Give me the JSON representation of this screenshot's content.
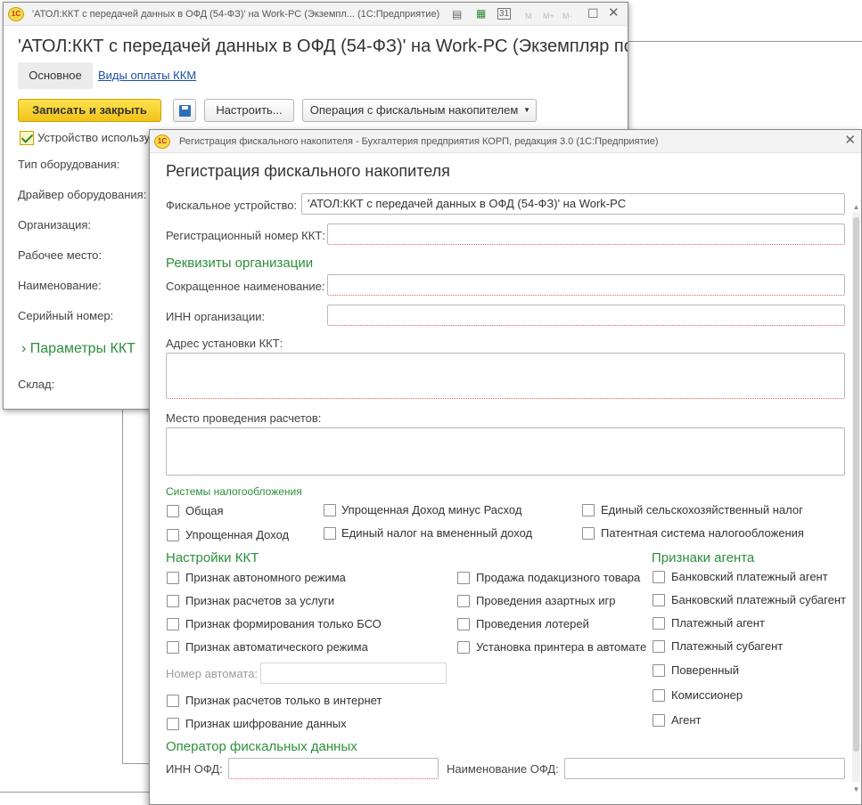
{
  "background_window": {
    "title": "'АТОЛ:ККТ с передачей данных в ОФД (54-ФЗ)' на Work-PC (Экземпл...   (1С:Предприятие)",
    "heading": "'АТОЛ:ККТ с передачей данных в ОФД (54-ФЗ)' на Work-PC (Экземпляр по...",
    "tabs": [
      "Основное",
      "Виды оплаты ККМ"
    ],
    "buttons": {
      "save_close": "Записать и закрыть",
      "configure": "Настроить...",
      "fiscal_op": "Операция с фискальным накопителем"
    },
    "checkbox_device": "Устройство использу",
    "fields": [
      "Тип оборудования:",
      "Драйвер оборудования:",
      "Организация:",
      "Рабочее место:",
      "Наименование:",
      "Серийный номер:"
    ],
    "params_section": "Параметры ККТ",
    "warehouse_label": "Склад:",
    "toolbar_dim": [
      "M",
      "M+",
      "M-"
    ],
    "calendar_day": "31"
  },
  "dialog": {
    "title": "Регистрация фискального накопителя - Бухгалтерия предприятия КОРП, редакция 3.0  (1С:Предприятие)",
    "heading": "Регистрация фискального накопителя",
    "fiscal_device_label": "Фискальное устройство:",
    "fiscal_device_value": "'АТОЛ:ККТ с передачей данных в ОФД (54-ФЗ)' на Work-PC",
    "reg_number_label": "Регистрационный номер ККТ:",
    "org_section": "Реквизиты организации",
    "short_name_label": "Сокращенное наименование:",
    "inn_label": "ИНН организации:",
    "address_label": "Адрес установки ККТ:",
    "place_label": "Место проведения расчетов:",
    "tax_section": "Системы налогообложения",
    "tax_options": {
      "general": "Общая",
      "simplified_income_minus": "Упрощенная Доход минус Расход",
      "agricultural": "Единый сельскохозяйственный налог",
      "simplified_income": "Упрощенная Доход",
      "imputed": "Единый налог на вмененный доход",
      "patent": "Патентная система налогообложения"
    },
    "kkt_section": "Настройки ККТ",
    "kkt_options": {
      "autonomous": "Признак автономного режима",
      "services": "Признак расчетов за услуги",
      "bso_only": "Признак формирования только БСО",
      "automatic": "Признак автоматического режима",
      "internet_only": "Признак расчетов только в интернет",
      "encryption": "Признак шифрование данных",
      "excise": "Продажа подакцизного товара",
      "gambling": "Проведения азартных игр",
      "lottery": "Проведения лотерей",
      "printer_in_machine": "Установка принтера в автомате"
    },
    "machine_number_label": "Номер автомата:",
    "agent_section": "Признаки агента",
    "agent_options": {
      "bank_agent": "Банковский платежный агент",
      "bank_subagent": "Банковский платежный субагент",
      "pay_agent": "Платежный агент",
      "pay_subagent": "Платежный субагент",
      "attorney": "Поверенный",
      "commissioner": "Комиссионер",
      "agent": "Агент"
    },
    "ofd_section": "Оператор фискальных данных",
    "ofd_inn_label": "ИНН ОФД:",
    "ofd_name_label": "Наименование ОФД:"
  },
  "logo_text": "1С",
  "colors": {
    "accent_green": "#2c8f3a",
    "link_blue": "#1d4fa0",
    "primary_button": "#f1c21a",
    "required_underline": "#e06060"
  }
}
